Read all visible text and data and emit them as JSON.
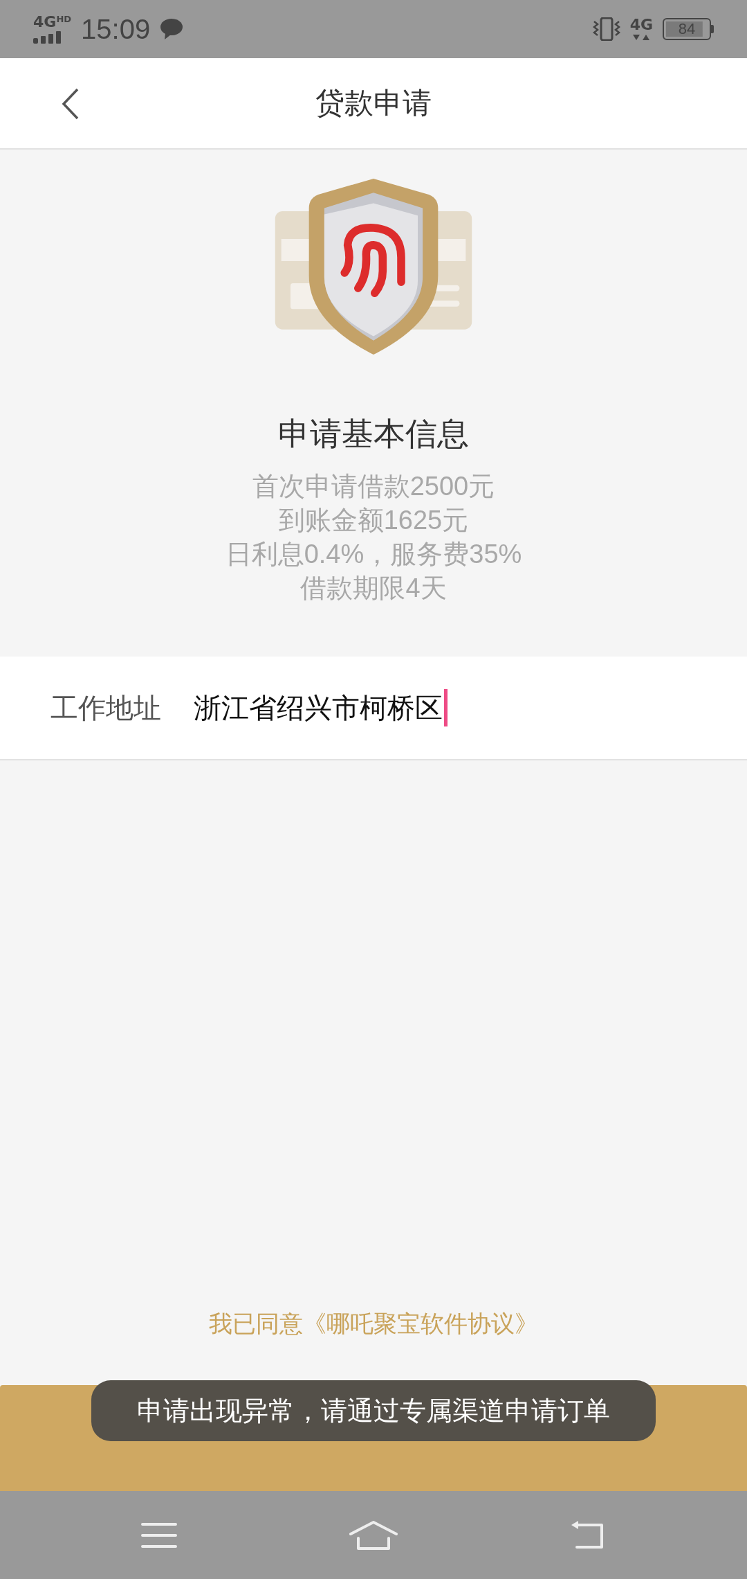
{
  "status_bar": {
    "network": "4G",
    "network_badge": "HD",
    "time": "15:09",
    "data_network": "4G",
    "battery": "84"
  },
  "header": {
    "title": "贷款申请"
  },
  "intro": {
    "title": "申请基本信息",
    "lines": [
      "首次申请借款2500元",
      "到账金额1625元",
      "日利息0.4%，服务费35%",
      "借款期限4天"
    ]
  },
  "form": [
    {
      "label": "工作地址",
      "value": "浙江省绍兴市柯桥区",
      "focused": true
    }
  ],
  "agreement": "我已同意《哪吒聚宝软件协议》",
  "toast": "申请出现异常，请通过专属渠道申请订单"
}
